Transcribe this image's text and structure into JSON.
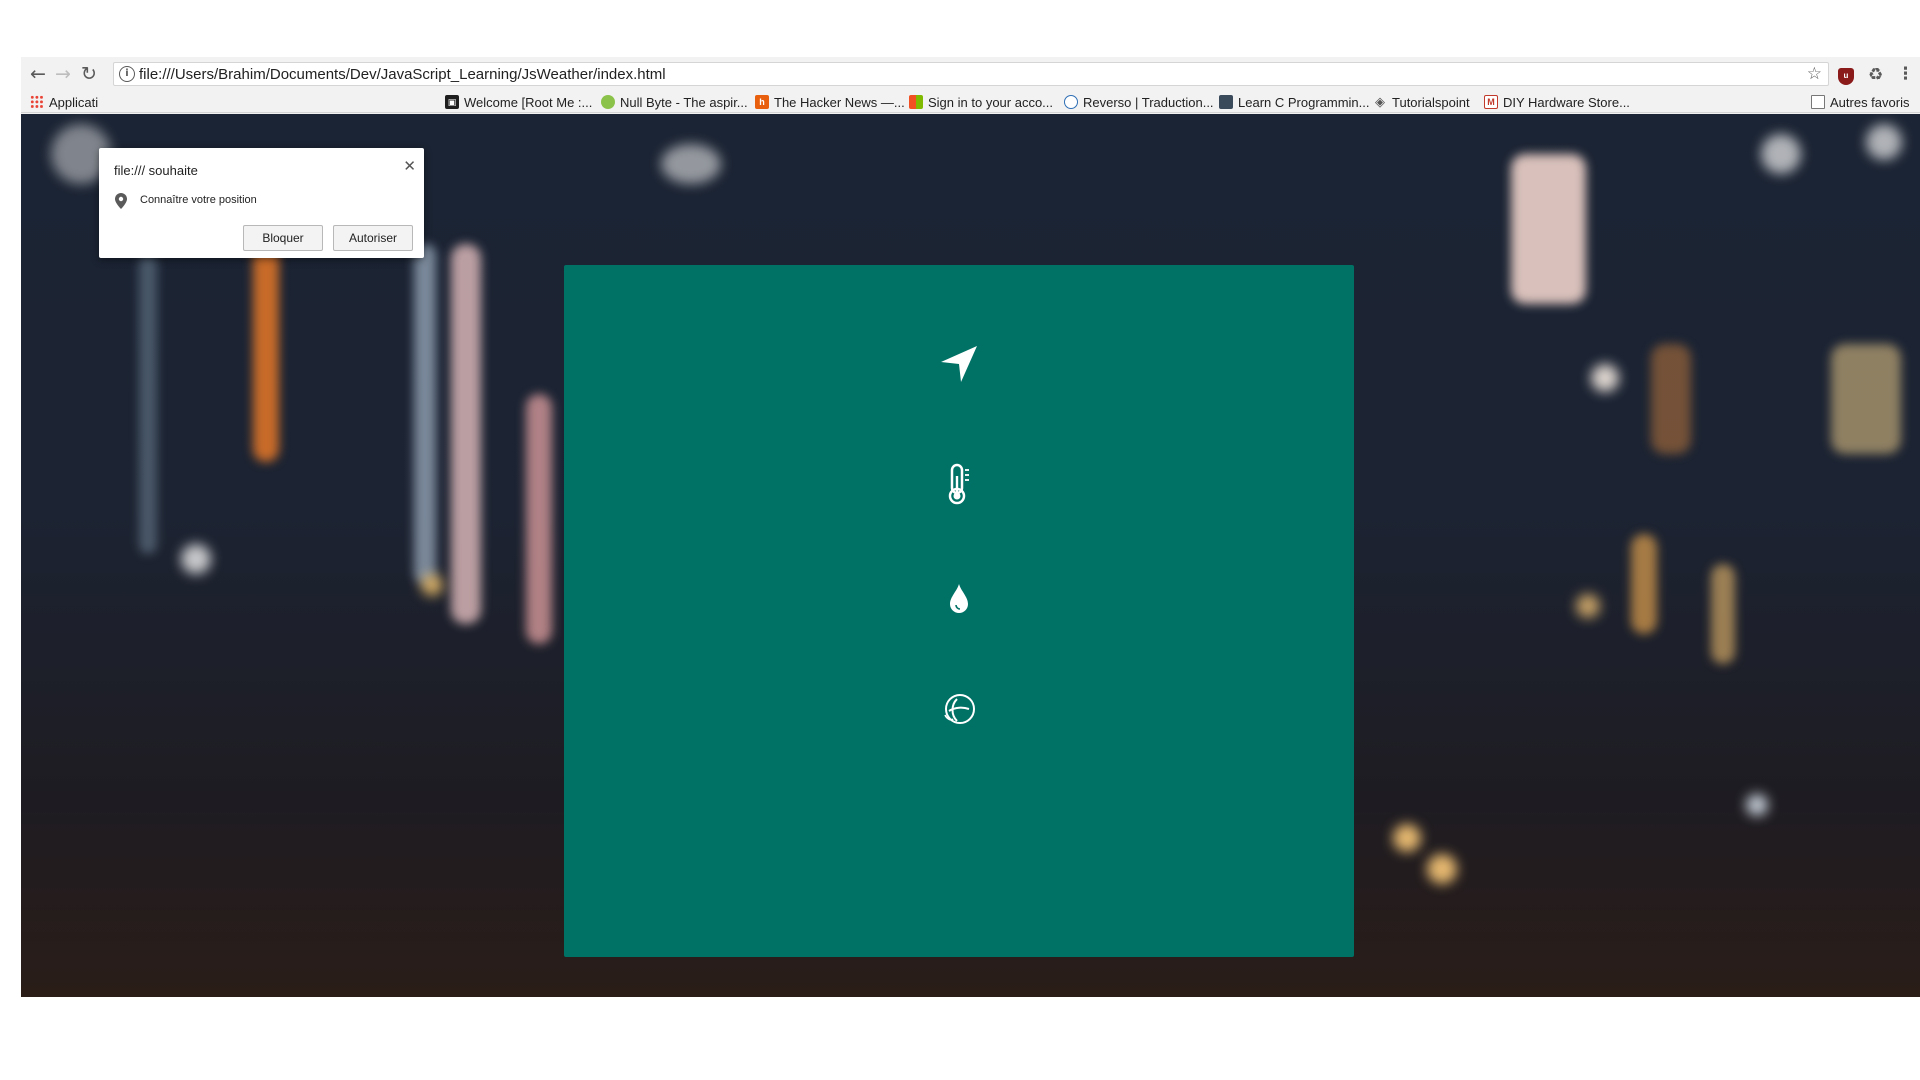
{
  "browser": {
    "url": "file:///Users/Brahim/Documents/Dev/JavaScript_Learning/JsWeather/index.html",
    "bookmarks": [
      {
        "label": "Applicati",
        "icon": "apps-grid-icon"
      },
      {
        "label": "Welcome [Root Me :...",
        "icon": "rootme-icon"
      },
      {
        "label": "Null Byte - The aspir...",
        "icon": "nullbyte-icon"
      },
      {
        "label": "The Hacker News —...",
        "icon": "hackernews-icon"
      },
      {
        "label": "Sign in to your acco...",
        "icon": "microsoft-icon"
      },
      {
        "label": "Reverso | Traduction...",
        "icon": "reverso-icon"
      },
      {
        "label": "Learn C Programmin...",
        "icon": "learnc-icon"
      },
      {
        "label": "Tutorialspoint",
        "icon": "tutorialspoint-icon"
      },
      {
        "label": "DIY Hardware Store...",
        "icon": "gmail-icon"
      }
    ],
    "other_bookmarks": "Autres favoris"
  },
  "permission_prompt": {
    "title": "file:/// souhaite",
    "request": "Connaître votre position",
    "block_label": "Bloquer",
    "allow_label": "Autoriser"
  },
  "weather_card": {
    "background_color": "#007165",
    "icons": [
      "location-arrow-icon",
      "thermometer-icon",
      "water-drop-icon",
      "wind-globe-icon"
    ]
  }
}
